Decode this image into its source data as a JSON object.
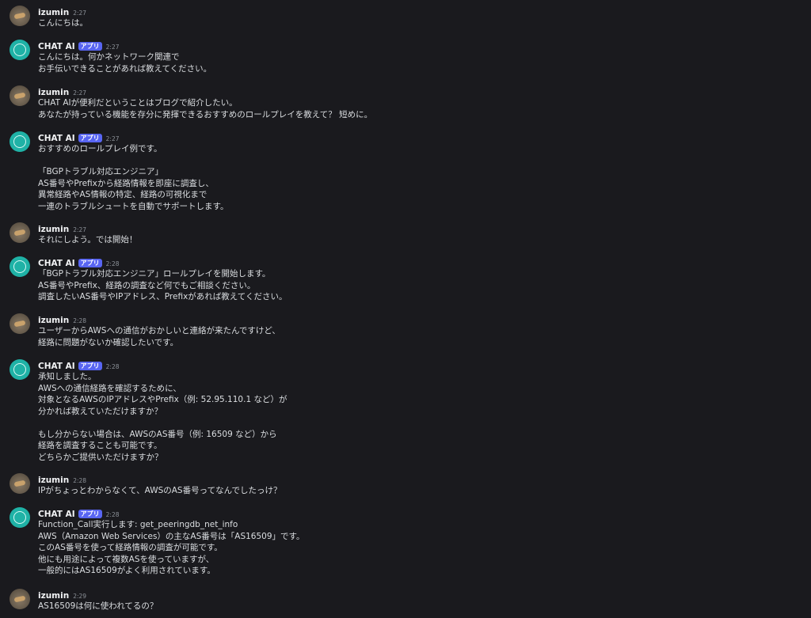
{
  "messages": [
    {
      "author": "izumin",
      "type": "user",
      "time": "2:27",
      "lines": [
        "こんにちは。"
      ]
    },
    {
      "author": "CHAT AI",
      "type": "bot",
      "badge": "アプリ",
      "time": "2:27",
      "lines": [
        "こんにちは。何かネットワーク関連で",
        "お手伝いできることがあれば教えてください。"
      ]
    },
    {
      "author": "izumin",
      "type": "user",
      "time": "2:27",
      "lines": [
        "CHAT AIが便利だということはブログで紹介したい。",
        "あなたが持っている機能を存分に発揮できるおすすめのロールプレイを教えて？ 短めに。"
      ]
    },
    {
      "author": "CHAT AI",
      "type": "bot",
      "badge": "アプリ",
      "time": "2:27",
      "lines": [
        "おすすめのロールプレイ例です。",
        "",
        "「BGPトラブル対応エンジニア」",
        "AS番号やPrefixから経路情報を即座に調査し、",
        "異常経路やAS情報の特定、経路の可視化まで",
        "一連のトラブルシュートを自動でサポートします。"
      ]
    },
    {
      "author": "izumin",
      "type": "user",
      "time": "2:27",
      "lines": [
        "それにしよう。では開始！"
      ]
    },
    {
      "author": "CHAT AI",
      "type": "bot",
      "badge": "アプリ",
      "time": "2:28",
      "lines": [
        "「BGPトラブル対応エンジニア」ロールプレイを開始します。",
        "AS番号やPrefix、経路の調査など何でもご相談ください。",
        "調査したいAS番号やIPアドレス、Prefixがあれば教えてください。"
      ]
    },
    {
      "author": "izumin",
      "type": "user",
      "time": "2:28",
      "lines": [
        "ユーザーからAWSへの通信がおかしいと連絡が来たんですけど、",
        "経路に問題がないか確認したいです。"
      ]
    },
    {
      "author": "CHAT AI",
      "type": "bot",
      "badge": "アプリ",
      "time": "2:28",
      "lines": [
        "承知しました。",
        "AWSへの通信経路を確認するために、",
        "対象となるAWSのIPアドレスやPrefix（例: 52.95.110.1 など）が",
        "分かれば教えていただけますか？",
        "",
        "もし分からない場合は、AWSのAS番号（例: 16509 など）から",
        "経路を調査することも可能です。",
        "どちらかご提供いただけますか？"
      ]
    },
    {
      "author": "izumin",
      "type": "user",
      "time": "2:28",
      "lines": [
        "IPがちょっとわからなくて、AWSのAS番号ってなんでしたっけ？"
      ]
    },
    {
      "author": "CHAT AI",
      "type": "bot",
      "badge": "アプリ",
      "time": "2:28",
      "lines": [
        "Function_Call実行します: get_peeringdb_net_info",
        "AWS（Amazon Web Services）の主なAS番号は「AS16509」です。",
        "このAS番号を使って経路情報の調査が可能です。",
        "他にも用途によって複数ASを使っていますが、",
        "一般的にはAS16509がよく利用されています。"
      ]
    },
    {
      "author": "izumin",
      "type": "user",
      "time": "2:29",
      "lines": [
        "AS16509は何に使われてるの？"
      ]
    }
  ],
  "icons": {
    "user": "user-avatar-icon",
    "bot": "chat-ai-bot-icon"
  },
  "colors": {
    "background": "#1a1a1e",
    "badge": "#5865f2",
    "bot_avatar": "#1fb2a6"
  }
}
